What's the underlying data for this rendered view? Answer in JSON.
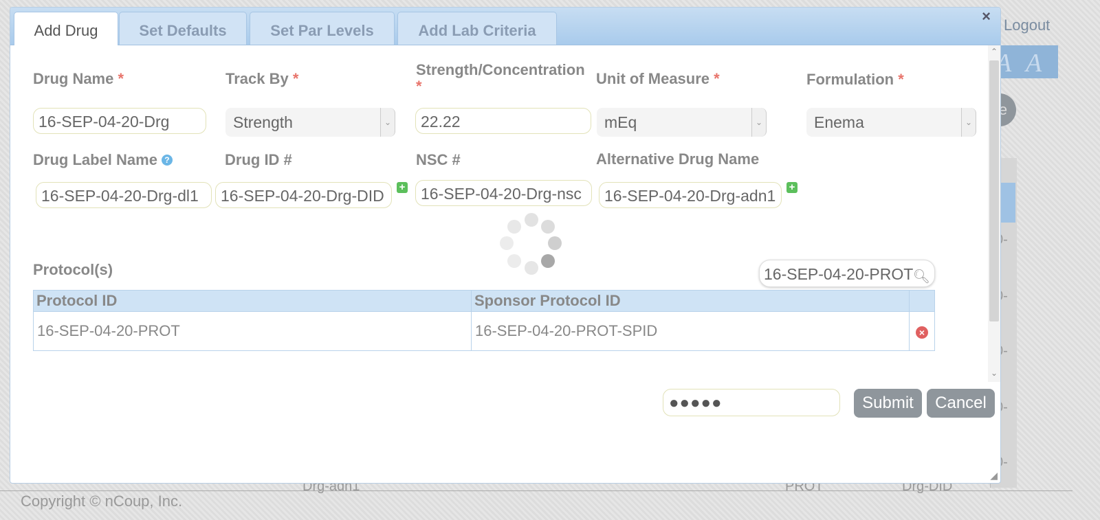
{
  "background": {
    "logout_label": "Logout",
    "bg_button_fragment": "e",
    "cell_fragments": [
      "0-",
      "0-",
      "0-",
      "0-",
      "0-"
    ],
    "bottom_fragments": [
      "Drg-adn1",
      "PROT",
      "Drg-DID"
    ],
    "copyright": "Copyright © nCoup, Inc."
  },
  "dialog": {
    "close_label": "×",
    "tabs": [
      {
        "label": "Add Drug",
        "active": true
      },
      {
        "label": "Set Defaults",
        "active": false
      },
      {
        "label": "Set Par Levels",
        "active": false
      },
      {
        "label": "Add Lab Criteria",
        "active": false
      }
    ]
  },
  "form": {
    "drug_name": {
      "label": "Drug Name",
      "required": "*",
      "value": "16-SEP-04-20-Drg"
    },
    "track_by": {
      "label": "Track By",
      "required": "*",
      "value": "Strength"
    },
    "strength": {
      "label": "Strength/Concentration",
      "required": "*",
      "value": "22.22"
    },
    "unit": {
      "label": "Unit of Measure",
      "required": "*",
      "value": "mEq"
    },
    "formulation": {
      "label": "Formulation",
      "required": "*",
      "value": "Enema"
    },
    "drug_label_name": {
      "label": "Drug Label Name",
      "help": "?",
      "value": "16-SEP-04-20-Drg-dl1"
    },
    "drug_id": {
      "label": "Drug ID #",
      "value": "16-SEP-04-20-Drg-DID"
    },
    "nsc": {
      "label": "NSC #",
      "value": "16-SEP-04-20-Drg-nsc"
    },
    "alt_name": {
      "label": "Alternative Drug Name",
      "value": "16-SEP-04-20-Drg-adn1"
    },
    "plus_glyph": "+"
  },
  "protocols": {
    "title": "Protocol(s)",
    "search_value": "16-SEP-04-20-PROT",
    "columns": [
      "Protocol ID",
      "Sponsor Protocol ID"
    ],
    "rows": [
      {
        "protocol_id": "16-SEP-04-20-PROT",
        "sponsor_id": "16-SEP-04-20-PROT-SPID",
        "delete": "×"
      }
    ]
  },
  "footer": {
    "password_mask": "●●●●●",
    "submit_label": "Submit",
    "cancel_label": "Cancel"
  },
  "colors": {
    "accent": "#a9cbec",
    "required": "#e8746b",
    "button": "#8f969c"
  }
}
